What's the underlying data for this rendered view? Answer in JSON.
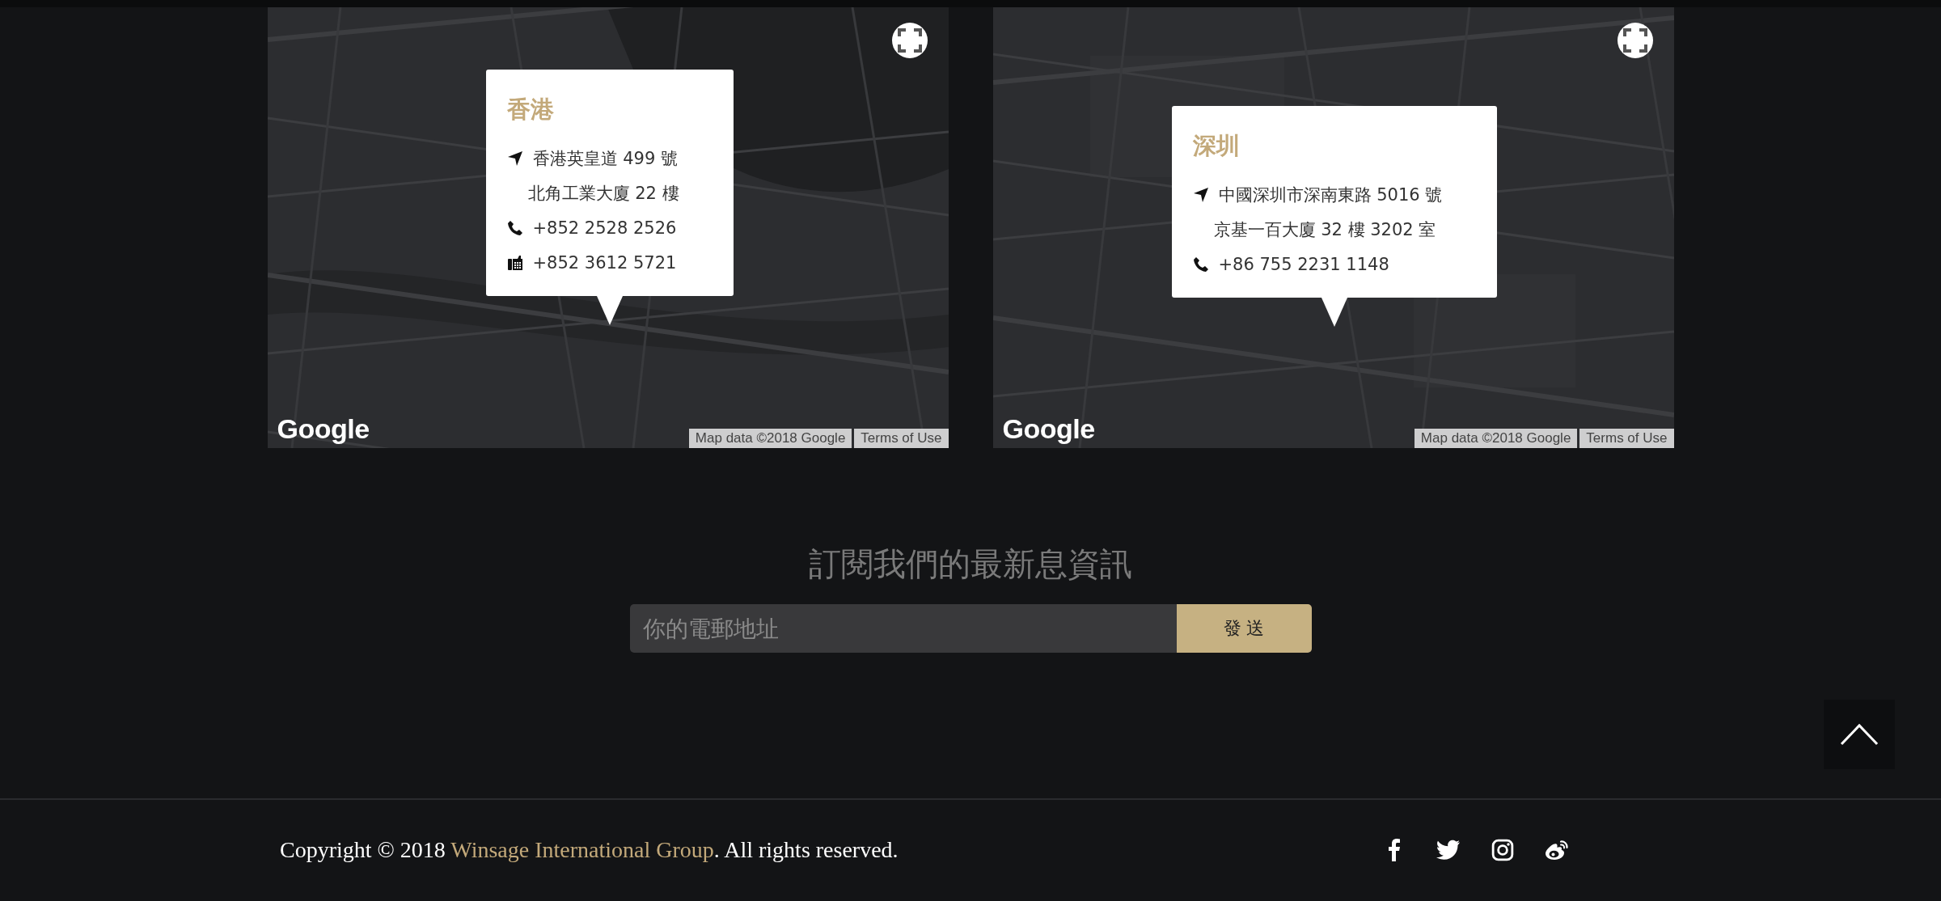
{
  "maps": [
    {
      "popup": {
        "title": "香港",
        "address": [
          "香港英皇道 499 號",
          "北角工業大廈 22 樓"
        ],
        "contacts": [
          {
            "kind": "phone",
            "text": "+852 2528 2526"
          },
          {
            "kind": "fax",
            "text": "+852 3612 5721"
          }
        ]
      },
      "logo": "Google",
      "attribution": "Map data ©2018 Google",
      "terms": "Terms of Use"
    },
    {
      "popup": {
        "title": "深圳",
        "address": [
          "中國深圳市深南東路 5016 號",
          "京基一百大廈 32 樓 3202 室"
        ],
        "contacts": [
          {
            "kind": "phone",
            "text": "+86 755 2231 1148"
          }
        ]
      },
      "logo": "Google",
      "attribution": "Map data ©2018 Google",
      "terms": "Terms of Use"
    }
  ],
  "newsletter": {
    "heading": "訂閱我們的最新息資訊",
    "email": {
      "placeholder": "你的電郵地址"
    },
    "submit": "發 送"
  },
  "footer": {
    "copyright": {
      "before": "Copyright © 2018 ",
      "link": "Winsage International Group",
      "after": ". All rights reserved."
    },
    "social": [
      {
        "kind": "facebook"
      },
      {
        "kind": "twitter"
      },
      {
        "kind": "instagram"
      },
      {
        "kind": "weibo"
      }
    ]
  }
}
